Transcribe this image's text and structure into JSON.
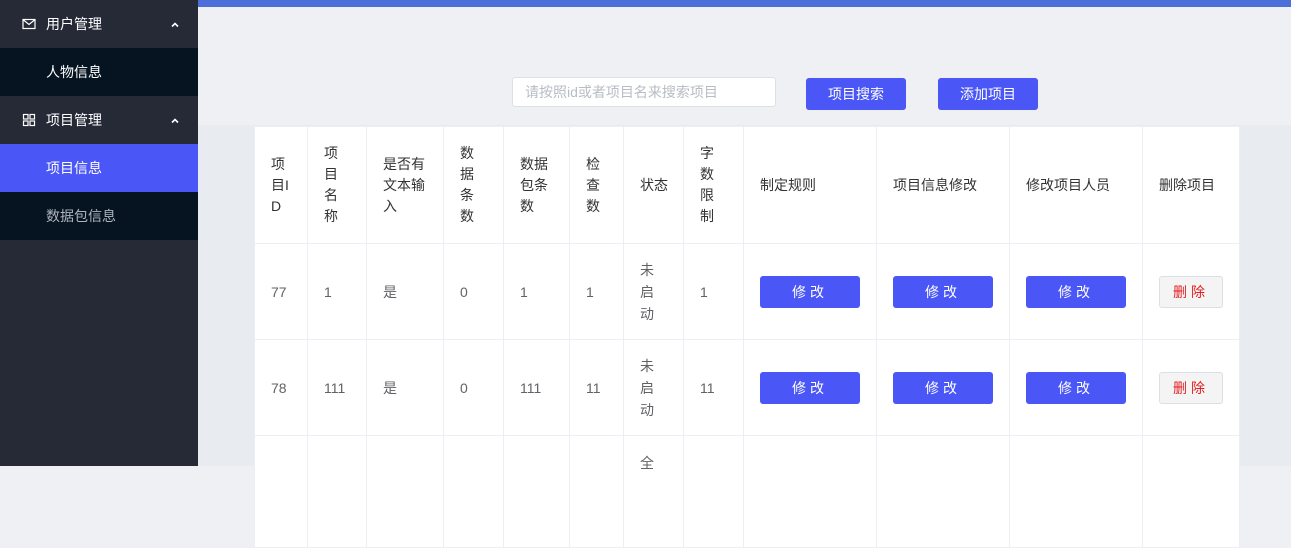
{
  "sidebar": {
    "groups": [
      {
        "title": "用户管理",
        "icon": "mail-icon",
        "items": [
          {
            "label": "人物信息"
          }
        ]
      },
      {
        "title": "项目管理",
        "icon": "grid-icon",
        "items": [
          {
            "label": "项目信息"
          },
          {
            "label": "数据包信息"
          }
        ]
      }
    ]
  },
  "toolbar": {
    "search_placeholder": "请按照id或者项目名来搜索项目",
    "search_label": "项目搜索",
    "add_label": "添加项目"
  },
  "table": {
    "headers": [
      "项目ID",
      "项目名称",
      "是否有文本输入",
      "数据条数",
      "数据包条数",
      "检查数",
      "状态",
      "字数限制",
      "制定规则",
      "项目信息修改",
      "修改项目人员",
      "删除项目"
    ],
    "rows": [
      {
        "id": "77",
        "name": "1",
        "text_input": "是",
        "data_count": "0",
        "package_count": "1",
        "check_count": "1",
        "status": "未启动",
        "word_limit": "1"
      },
      {
        "id": "78",
        "name": "111",
        "text_input": "是",
        "data_count": "0",
        "package_count": "111",
        "check_count": "11",
        "status": "未启动",
        "word_limit": "11"
      },
      {
        "id": "",
        "name": "",
        "text_input": "",
        "data_count": "",
        "package_count": "",
        "check_count": "",
        "status": "全",
        "word_limit": ""
      }
    ],
    "edit_label": "修改",
    "delete_label": "删除"
  },
  "colors": {
    "accent": "#4a56f5",
    "sidebar_bg": "#262a37",
    "submenu_bg": "#061320",
    "topbar": "#4b6ed8",
    "danger": "#e02020"
  }
}
